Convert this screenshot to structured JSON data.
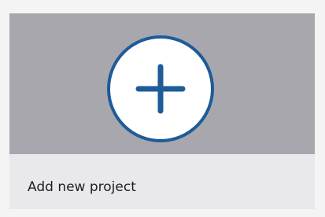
{
  "card": {
    "label": "Add new project",
    "icon": "plus-icon"
  },
  "colors": {
    "page_background": "#f4f4f5",
    "card_background": "#e9e9ec",
    "thumbnail_background": "#a7a7ad",
    "accent": "#1e5b99",
    "text": "#1f1f1f"
  }
}
